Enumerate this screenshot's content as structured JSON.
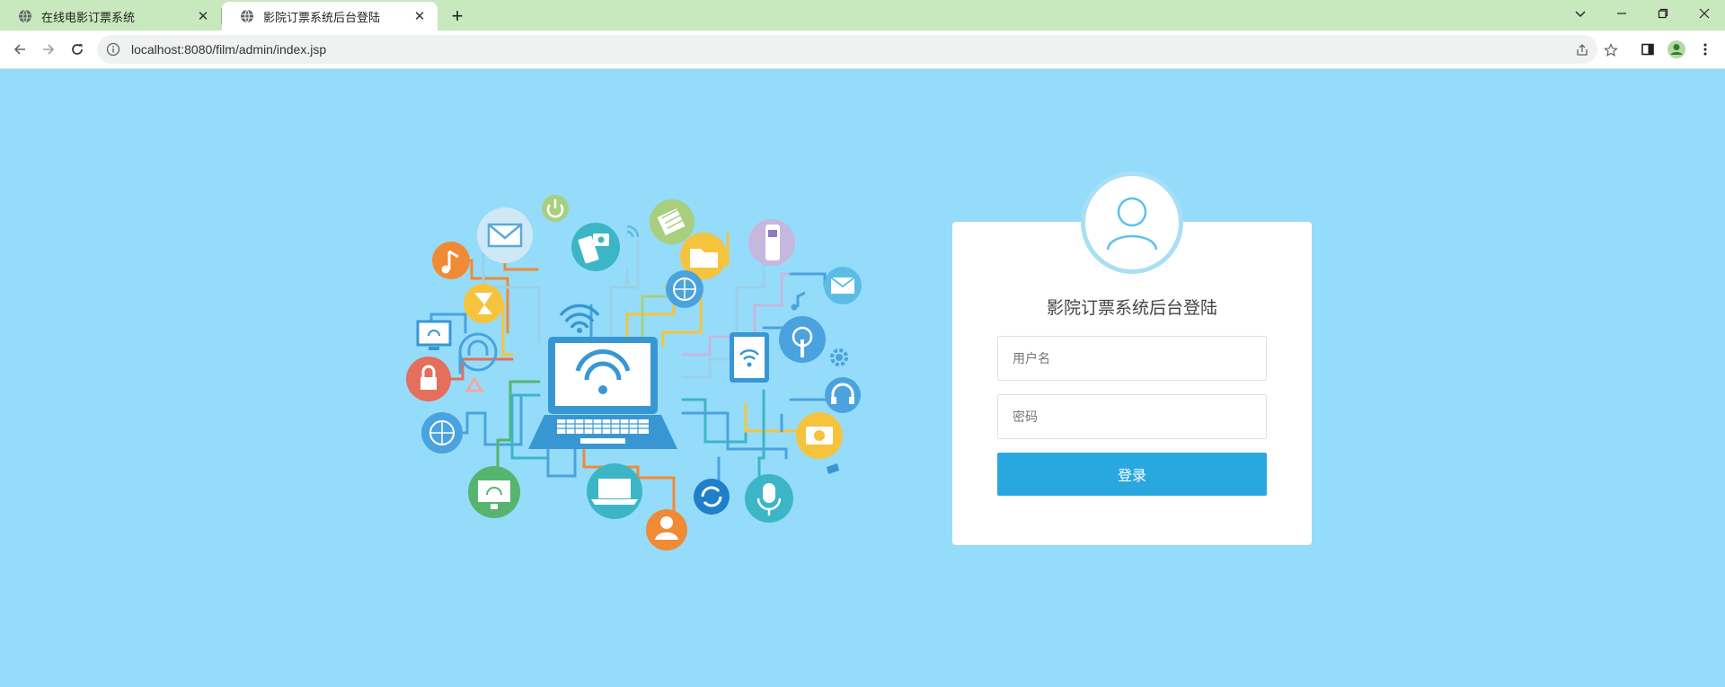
{
  "browser": {
    "tabs": [
      {
        "title": "在线电影订票系统",
        "active": false
      },
      {
        "title": "影院订票系统后台登陆",
        "active": true
      }
    ],
    "new_tab_label": "+",
    "url": "localhost:8080/film/admin/index.jsp",
    "icons": [
      "globe-icon",
      "close-icon",
      "back-arrow-icon",
      "forward-arrow-icon",
      "reload-icon",
      "info-icon",
      "share-icon",
      "star-icon",
      "side-panel-icon",
      "profile-icon",
      "more-menu-icon",
      "chevron-down-icon",
      "minimize-icon",
      "restore-icon"
    ]
  },
  "page": {
    "background": "#95dcfa",
    "illustration_icon": "network-devices-illustration"
  },
  "login": {
    "title": "影院订票系统后台登陆",
    "username_placeholder": "用户名",
    "password_placeholder": "密码",
    "submit_label": "登录",
    "accent_color": "#29a8e0",
    "avatar_icon": "user-avatar-icon"
  }
}
